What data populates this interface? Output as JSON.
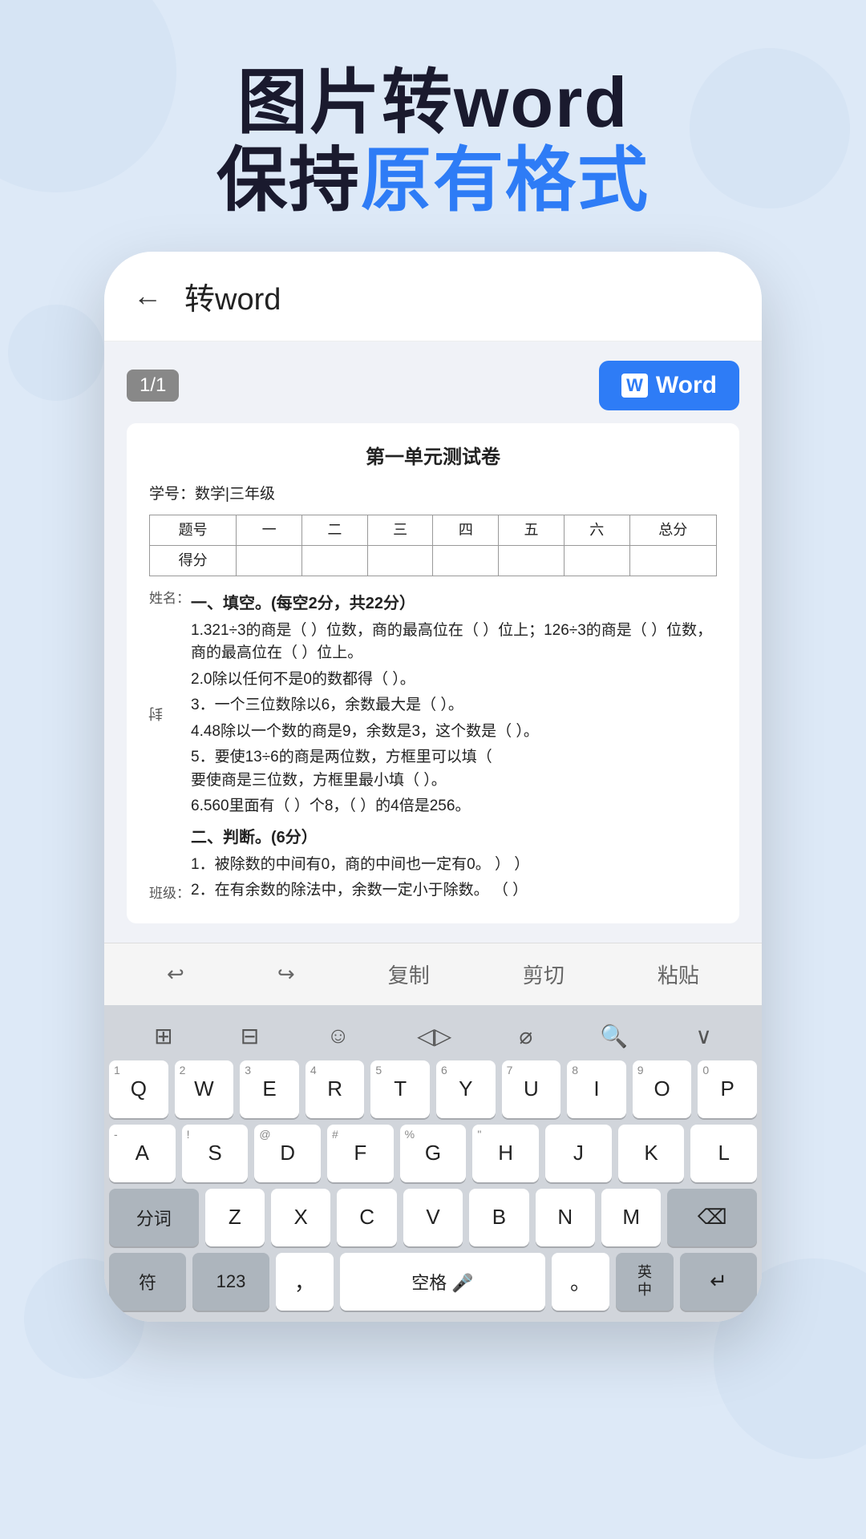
{
  "header": {
    "line1": "图片转word",
    "line2_prefix": "保持",
    "line2_blue": "原有格式",
    "line2_suffix": ""
  },
  "topbar": {
    "back": "←",
    "title": "转word"
  },
  "toolbar": {
    "page_badge": "1/1",
    "word_button": "Word"
  },
  "document": {
    "title": "第一单元测试卷",
    "meta_label": "学号：",
    "meta_value": "数学|三年级",
    "table_headers": [
      "题号",
      "一",
      "二",
      "三",
      "四",
      "五",
      "六",
      "总分"
    ],
    "table_row": [
      "得分",
      "",
      "",
      "",
      "",
      "",
      "",
      ""
    ],
    "side_label_name": "姓名：",
    "side_label_seal": "封",
    "side_label_class": "班级：",
    "sections": [
      {
        "heading": "一、填空。(每空2分，共22分）",
        "questions": [
          "1.321÷3的商是（ ）位数，商的最高位在（ ）位上；126÷3的商是（ ）位数，商的最高位在（ ）位上。",
          "2.0除以任何不是0的数都得（ ）。",
          "3．一个三位数除以6，余数最大是（ ）。",
          "4.48除以一个数的商是9，余数是3，这个数是（ ）。",
          "5．要使13÷6的商是两位数，方框里可以填（ 要使商是三位数，方框里最小填（ ）。",
          "6.560里面有（  ）个8，（ ）的4倍是256。"
        ]
      },
      {
        "heading": "二、判断。(6分）",
        "questions": [
          "1．被除数的中间有0，商的中间也一定有0。   ）           ）",
          "2．在有余数的除法中，余数一定小于除数。  （ ）"
        ]
      }
    ]
  },
  "edit_toolbar": {
    "undo": "↩",
    "redo": "↪",
    "copy": "复制",
    "cut": "剪切",
    "paste": "粘贴"
  },
  "keyboard": {
    "top_bar": [
      "⊞",
      "⊟",
      "☺",
      "◁▷",
      "⌀",
      "🔍",
      "∨"
    ],
    "rows": [
      {
        "keys": [
          {
            "label": "Q",
            "sub": "1"
          },
          {
            "label": "W",
            "sub": "2"
          },
          {
            "label": "E",
            "sub": "3"
          },
          {
            "label": "R",
            "sub": "4"
          },
          {
            "label": "T",
            "sub": "5"
          },
          {
            "label": "Y",
            "sub": "6"
          },
          {
            "label": "U",
            "sub": "7"
          },
          {
            "label": "I",
            "sub": "8"
          },
          {
            "label": "O",
            "sub": "9"
          },
          {
            "label": "P",
            "sub": "0"
          }
        ]
      },
      {
        "keys": [
          {
            "label": "A",
            "sub": "-"
          },
          {
            "label": "S",
            "sub": "!"
          },
          {
            "label": "D",
            "sub": "@"
          },
          {
            "label": "F",
            "sub": "#"
          },
          {
            "label": "G",
            "sub": "%"
          },
          {
            "label": "H",
            "sub": "\""
          },
          {
            "label": "J",
            "sub": ""
          },
          {
            "label": "K",
            "sub": ""
          },
          {
            "label": "L",
            "sub": ""
          }
        ]
      }
    ],
    "bottom_row_left": "分词",
    "bottom_row_keys": [
      "Z",
      "X",
      "C",
      "V",
      "B",
      "N",
      "M"
    ],
    "bottom_row_delete": "⌫",
    "last_row": {
      "symbol": "符",
      "num": "123",
      "comma": "，",
      "space": "空格",
      "period": "。",
      "lang": "英\n中",
      "enter": "↵"
    }
  }
}
